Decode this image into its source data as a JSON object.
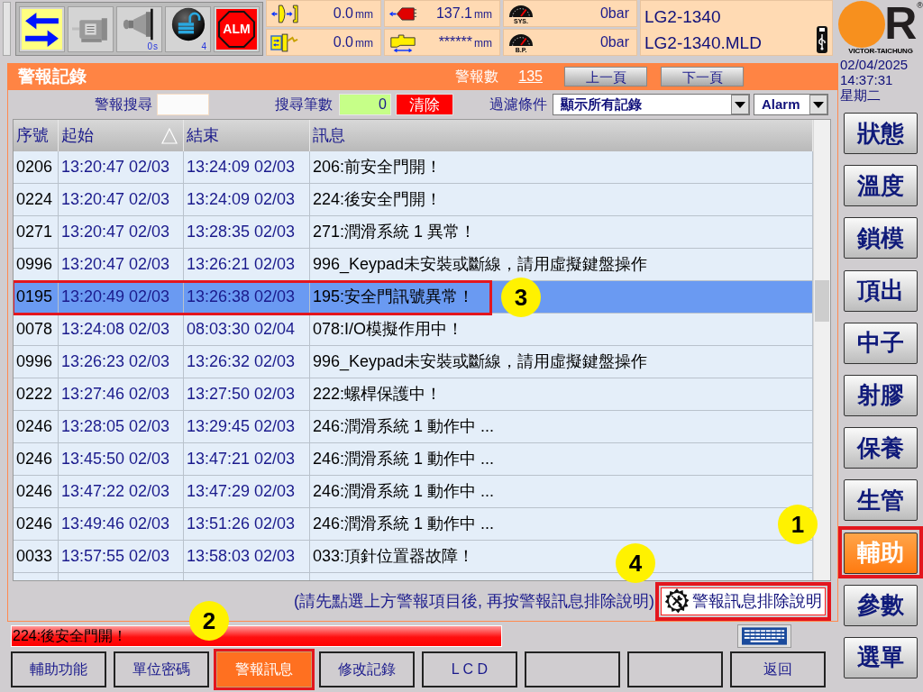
{
  "toolbar": {
    "tools": [
      {
        "kind": "swap"
      },
      {
        "kind": "motor"
      },
      {
        "kind": "nozzle",
        "caption": "0s"
      },
      {
        "kind": "unlock",
        "caption": "4"
      },
      {
        "kind": "alarm",
        "caption": "ALM"
      }
    ]
  },
  "readouts": [
    {
      "kind": "mold-stroke",
      "value": "0.0",
      "unit": "mm"
    },
    {
      "kind": "injection",
      "value": "137.1",
      "unit": "mm"
    },
    {
      "kind": "gauge",
      "gauge_label": "SYS.",
      "value": "0bar"
    },
    {
      "kind": "ejector",
      "value": "0.0",
      "unit": "mm"
    },
    {
      "kind": "carriage",
      "value": "******",
      "unit": "mm"
    },
    {
      "kind": "gauge",
      "gauge_label": "B.P.",
      "value": "0bar"
    }
  ],
  "mold": {
    "name": "LG2-1340",
    "file": "LG2-1340.MLD"
  },
  "logo": {
    "mark": "R",
    "registered": "®",
    "brand": "VICTOR-TAICHUNG"
  },
  "clock": {
    "date": "02/04/2025",
    "time": "14:37:31",
    "weekday": "星期二"
  },
  "alarm_log": {
    "title": "警報記錄",
    "count_label": "警報數",
    "count": "135",
    "pager": [
      "上一頁",
      "下一頁"
    ],
    "search": {
      "label": "警報搜尋",
      "hits_label": "搜尋筆數",
      "hits": "0",
      "clear": "清除",
      "filter_label": "過濾條件",
      "filter": "顯示所有記錄",
      "type": "Alarm"
    },
    "table": {
      "columns": [
        {
          "label": "序號",
          "sorted": false
        },
        {
          "label": "起始",
          "sorted": true
        },
        {
          "label": "結束",
          "sorted": false
        },
        {
          "label": "訊息",
          "sorted": false
        }
      ],
      "rows": [
        {
          "cells": [
            "0206",
            "13:20:47 02/03",
            "13:24:09 02/03",
            "206:前安全門開！"
          ],
          "selected": false,
          "highlighted": false
        },
        {
          "cells": [
            "0224",
            "13:20:47 02/03",
            "13:24:09 02/03",
            "224:後安全門開！"
          ],
          "selected": false,
          "highlighted": false
        },
        {
          "cells": [
            "0271",
            "13:20:47 02/03",
            "13:28:35 02/03",
            "271:潤滑系統 1 異常！"
          ],
          "selected": false,
          "highlighted": false
        },
        {
          "cells": [
            "0996",
            "13:20:47 02/03",
            "13:26:21 02/03",
            "996_Keypad未安裝或斷線，請用虛擬鍵盤操作"
          ],
          "selected": false,
          "highlighted": false
        },
        {
          "cells": [
            "0195",
            "13:20:49 02/03",
            "13:26:38 02/03",
            "195:安全門訊號異常！"
          ],
          "selected": true,
          "highlighted": true,
          "callout": "3"
        },
        {
          "cells": [
            "0078",
            "13:24:08 02/03",
            "08:03:30 02/04",
            "078:I/O模擬作用中！"
          ],
          "selected": false,
          "highlighted": false
        },
        {
          "cells": [
            "0996",
            "13:26:23 02/03",
            "13:26:32 02/03",
            "996_Keypad未安裝或斷線，請用虛擬鍵盤操作"
          ],
          "selected": false,
          "highlighted": false
        },
        {
          "cells": [
            "0222",
            "13:27:46 02/03",
            "13:27:50 02/03",
            "222:螺桿保護中！"
          ],
          "selected": false,
          "highlighted": false
        },
        {
          "cells": [
            "0246",
            "13:28:05 02/03",
            "13:29:45 02/03",
            "246:潤滑系統 1 動作中 ..."
          ],
          "selected": false,
          "highlighted": false
        },
        {
          "cells": [
            "0246",
            "13:45:50 02/03",
            "13:47:21 02/03",
            "246:潤滑系統 1 動作中 ..."
          ],
          "selected": false,
          "highlighted": false
        },
        {
          "cells": [
            "0246",
            "13:47:22 02/03",
            "13:47:29 02/03",
            "246:潤滑系統 1 動作中 ..."
          ],
          "selected": false,
          "highlighted": false
        },
        {
          "cells": [
            "0246",
            "13:49:46 02/03",
            "13:51:26 02/03",
            "246:潤滑系統 1 動作中 ..."
          ],
          "selected": false,
          "highlighted": false
        },
        {
          "cells": [
            "0033",
            "13:57:55 02/03",
            "13:58:03 02/03",
            "033:頂針位置器故障！"
          ],
          "selected": false,
          "highlighted": false
        }
      ]
    },
    "hint": "(請先點選上方警報項目後, 再按警報訊息排除說明)",
    "help_button": {
      "label": "警報訊息排除說明",
      "highlighted": true,
      "callout": "4"
    }
  },
  "current_alarm": "224:後安全門開！",
  "bottom_buttons": [
    {
      "label": "輔助功能",
      "selected": false,
      "highlighted": false
    },
    {
      "label": "單位密碼",
      "selected": false,
      "highlighted": false
    },
    {
      "label": "警報訊息",
      "selected": true,
      "highlighted": true,
      "callout": "2"
    },
    {
      "label": "修改記錄",
      "selected": false,
      "highlighted": false
    },
    {
      "label": "L C D",
      "selected": false,
      "highlighted": false
    },
    {
      "selected": false,
      "highlighted": false
    },
    {
      "selected": false,
      "highlighted": false
    },
    {
      "label": "返回",
      "selected": false,
      "highlighted": false
    }
  ],
  "side_menu": [
    {
      "label": "狀態",
      "selected": false,
      "highlighted": false
    },
    {
      "label": "溫度",
      "selected": false,
      "highlighted": false
    },
    {
      "label": "鎖模",
      "selected": false,
      "highlighted": false
    },
    {
      "label": "頂出",
      "selected": false,
      "highlighted": false
    },
    {
      "label": "中子",
      "selected": false,
      "highlighted": false
    },
    {
      "label": "射膠",
      "selected": false,
      "highlighted": false
    },
    {
      "label": "保養",
      "selected": false,
      "highlighted": false
    },
    {
      "label": "生管",
      "selected": false,
      "highlighted": false
    },
    {
      "label": "輔助",
      "selected": true,
      "highlighted": true,
      "callout": "1"
    },
    {
      "label": "參數",
      "selected": false,
      "highlighted": false
    },
    {
      "label": "選單",
      "selected": false,
      "highlighted": false
    }
  ]
}
